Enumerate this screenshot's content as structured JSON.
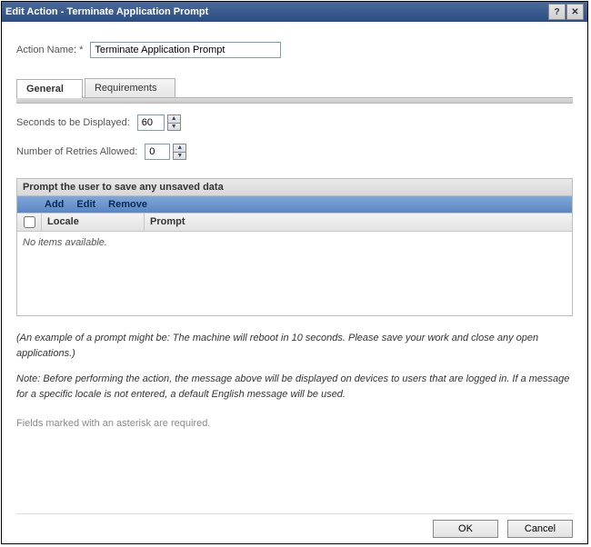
{
  "titlebar": {
    "title": "Edit Action - Terminate Application Prompt"
  },
  "form": {
    "action_name_label": "Action Name: *",
    "action_name_value": "Terminate Application Prompt",
    "seconds_label": "Seconds to be Displayed:",
    "seconds_value": "60",
    "retries_label": "Number of Retries Allowed:",
    "retries_value": "0"
  },
  "tabs": {
    "general": "General",
    "requirements": "Requirements"
  },
  "panel": {
    "title": "Prompt the user to save any unsaved data",
    "toolbar": {
      "add": "Add",
      "edit": "Edit",
      "remove": "Remove"
    },
    "columns": {
      "locale": "Locale",
      "prompt": "Prompt"
    },
    "empty": "No items available."
  },
  "example_text": "(An example of a prompt might be: The machine will reboot in 10 seconds. Please save your work and close any open applications.)",
  "note_text": "Note: Before performing the action, the message above will be displayed on devices to users that are logged in. If a message for a specific locale is not entered, a default English message will be used.",
  "disclaimer": "Fields marked with an asterisk are required.",
  "buttons": {
    "ok": "OK",
    "cancel": "Cancel"
  }
}
